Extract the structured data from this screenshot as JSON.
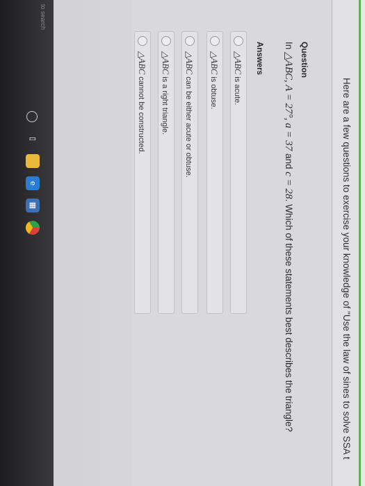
{
  "header": {
    "intro": "Here are a few questions to exercise your knowledge of \"Use the law of sines to solve SSA t"
  },
  "question": {
    "heading": "Question",
    "prefix": "In ",
    "triangle_math": "△ABC, A = 27°, a = 37",
    "and": " and ",
    "c_math": "c = 28",
    "suffix": ". Which of these statements best describes the triangle?"
  },
  "answers": {
    "heading": "Answers",
    "options": [
      {
        "math": "△ABC",
        "text": " is acute."
      },
      {
        "math": "△ABC",
        "text": " is obtuse."
      },
      {
        "math": "△ABC",
        "text": " can be either acute or obtuse."
      },
      {
        "math": "△ABC",
        "text": " is a right triangle."
      },
      {
        "math": "△ABC",
        "text": " cannot be constructed."
      }
    ]
  },
  "taskbar": {
    "search_text": "to search",
    "icons": [
      "cortana-icon",
      "task-view-icon",
      "file-explorer-icon",
      "edge-icon",
      "store-icon",
      "chrome-icon"
    ]
  },
  "colors": {
    "accent_green": "#58b44d",
    "edge_blue": "#2b7cd3",
    "chrome_red": "#d94335"
  }
}
